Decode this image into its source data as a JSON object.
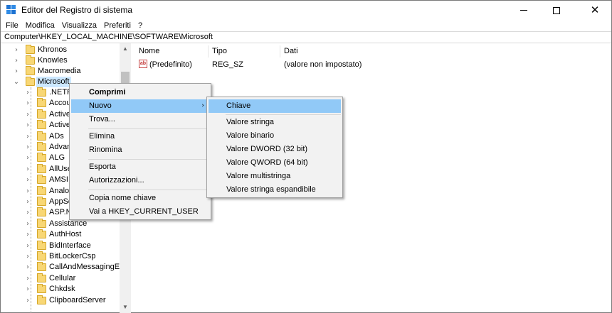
{
  "window": {
    "title": "Editor del Registro di sistema",
    "icon": "registry-editor-icon"
  },
  "menubar": [
    "File",
    "Modifica",
    "Visualizza",
    "Preferiti",
    "?"
  ],
  "address": "Computer\\HKEY_LOCAL_MACHINE\\SOFTWARE\\Microsoft",
  "tree": {
    "top_nodes": [
      "Khronos",
      "Knowles",
      "Macromedia",
      "Microsoft"
    ],
    "selected": "Microsoft",
    "children": [
      ".NETF",
      "Accou",
      "Active",
      "Active",
      "ADs",
      "Advan",
      "ALG",
      "AllUse",
      "AMSI",
      "Analo",
      "AppSe",
      "ASP.N",
      "Assistance",
      "AuthHost",
      "BidInterface",
      "BitLockerCsp",
      "CallAndMessagingEnh",
      "Cellular",
      "Chkdsk",
      "ClipboardServer"
    ]
  },
  "values_pane": {
    "columns": [
      "Nome",
      "Tipo",
      "Dati"
    ],
    "rows": [
      {
        "name": "(Predefinito)",
        "type": "REG_SZ",
        "data": "(valore non impostato)"
      }
    ]
  },
  "context_menu": {
    "items": [
      {
        "label": "Comprimi",
        "bold": true
      },
      {
        "label": "Nuovo",
        "submenu": true,
        "highlighted": true
      },
      {
        "label": "Trova..."
      },
      {
        "label": "Elimina"
      },
      {
        "label": "Rinomina"
      },
      {
        "label": "Esporta"
      },
      {
        "label": "Autorizzazioni..."
      },
      {
        "label": "Copia nome chiave"
      },
      {
        "label": "Vai a HKEY_CURRENT_USER"
      }
    ]
  },
  "submenu": {
    "items": [
      {
        "label": "Chiave",
        "highlighted": true
      },
      {
        "label": "Valore stringa"
      },
      {
        "label": "Valore binario"
      },
      {
        "label": "Valore DWORD (32 bit)"
      },
      {
        "label": "Valore QWORD (64 bit)"
      },
      {
        "label": "Valore multistringa"
      },
      {
        "label": "Valore stringa espandibile"
      }
    ]
  },
  "colors": {
    "menu_highlight": "#91c9f7",
    "tree_selection": "#cce8ff",
    "folder": "#f8d775"
  }
}
